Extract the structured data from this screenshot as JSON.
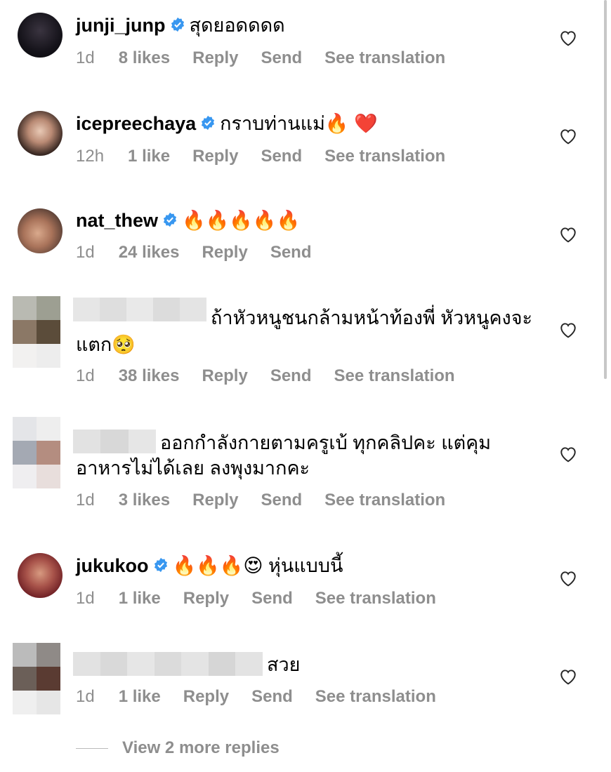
{
  "comments": [
    {
      "username": "junji_junp",
      "verified": true,
      "text": "สุดยอดดดด",
      "time": "1d",
      "likes": "8 likes",
      "reply": "Reply",
      "send": "Send",
      "translate": "See translation"
    },
    {
      "username": "icepreechaya",
      "verified": true,
      "text": "กราบท่านแม่🔥 ❤️",
      "time": "12h",
      "likes": "1 like",
      "reply": "Reply",
      "send": "Send",
      "translate": "See translation"
    },
    {
      "username": "nat_thew",
      "verified": true,
      "text": "🔥🔥🔥🔥🔥",
      "time": "1d",
      "likes": "24 likes",
      "reply": "Reply",
      "send": "Send"
    },
    {
      "username": "",
      "verified": false,
      "text": "ถ้าหัวหนูชนกล้ามหน้าท้องพี่ หัวหนูคงจะ",
      "text2": "แตก🥺",
      "time": "1d",
      "likes": "38 likes",
      "reply": "Reply",
      "send": "Send",
      "translate": "See translation"
    },
    {
      "username": "",
      "verified": false,
      "text": "ออกกำลังกายตามครูเบ้ ทุกคลิปคะ แต่คุม",
      "text2": "อาหารไม่ได้เลย ลงพุงมากคะ",
      "time": "1d",
      "likes": "3 likes",
      "reply": "Reply",
      "send": "Send",
      "translate": "See translation"
    },
    {
      "username": "jukukoo",
      "verified": true,
      "text": "🔥🔥🔥😍 หุ่นแบบนี้",
      "time": "1d",
      "likes": "1 like",
      "reply": "Reply",
      "send": "Send",
      "translate": "See translation"
    },
    {
      "username": "",
      "verified": false,
      "text": "สวย",
      "time": "1d",
      "likes": "1 like",
      "reply": "Reply",
      "send": "Send",
      "translate": "See translation"
    }
  ],
  "view_more": "View 2 more replies",
  "icons": {
    "verified": "verified-badge-icon",
    "like": "heart-outline-icon"
  },
  "colors": {
    "verified": "#3897f0",
    "meta": "#8e8e8e"
  }
}
